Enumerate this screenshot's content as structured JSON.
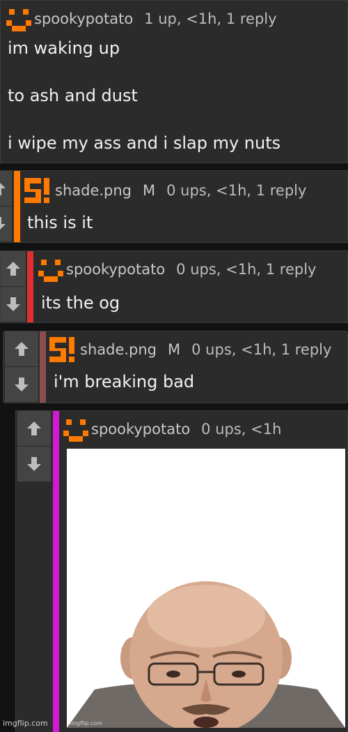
{
  "colors": {
    "orange": "#ff7a00",
    "red_bar": "#e03030",
    "brown_bar": "#8a4e4e",
    "magenta_bar": "#d21ad2",
    "panel": "#2b2b2b",
    "vote_bg": "#444444"
  },
  "comments": [
    {
      "user": "spookypotato",
      "avatar_icon": "smiley-pixel-icon",
      "meta": "1 up, <1h, 1 reply",
      "lines": [
        "im waking up",
        "to ash and dust",
        "i wipe my ass and i slap my nuts"
      ]
    },
    {
      "user": "shade.png",
      "avatar_icon": "s-exclaim-pixel-icon",
      "badge": "M",
      "meta": "0 ups, <1h, 1 reply",
      "text": "this is it",
      "bar_color": "#ff7a00"
    },
    {
      "user": "spookypotato",
      "avatar_icon": "smiley-pixel-icon",
      "meta": "0 ups, <1h, 1 reply",
      "text": "its the og",
      "bar_color": "#e03030"
    },
    {
      "user": "shade.png",
      "avatar_icon": "s-exclaim-pixel-icon",
      "badge": "M",
      "meta": "0 ups, <1h, 1 reply",
      "text": "i'm breaking bad",
      "bar_color": "#8a4e4e"
    },
    {
      "user": "spookypotato",
      "avatar_icon": "smiley-pixel-icon",
      "meta": "0 ups, <1h",
      "bar_color": "#d21ad2",
      "image_alt": "photo of bald man with glasses",
      "image_watermark": "imgflip.com"
    }
  ],
  "footer": {
    "watermark": "imgflip.com"
  }
}
